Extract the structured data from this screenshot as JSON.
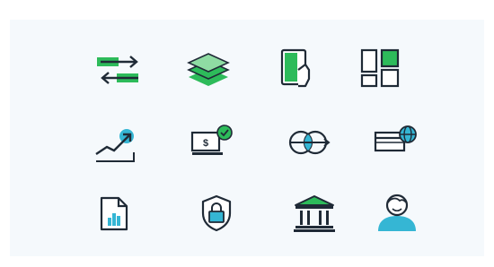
{
  "palette": {
    "ink": "#1f2a36",
    "green": "#2dbb5a",
    "green_light": "#8fdca3",
    "teal": "#35b6d4",
    "panel_bg": "#f5f9fc"
  },
  "icons": [
    {
      "row": 1,
      "col": 1,
      "name": "transfer-arrows-icon"
    },
    {
      "row": 1,
      "col": 2,
      "name": "stacked-layers-icon"
    },
    {
      "row": 1,
      "col": 3,
      "name": "tablet-hand-icon"
    },
    {
      "row": 1,
      "col": 4,
      "name": "dashboard-grid-icon"
    },
    {
      "row": 2,
      "col": 1,
      "name": "growth-chart-icon"
    },
    {
      "row": 2,
      "col": 2,
      "name": "verified-payment-icon"
    },
    {
      "row": 2,
      "col": 3,
      "name": "currency-exchange-icon"
    },
    {
      "row": 2,
      "col": 4,
      "name": "global-card-icon"
    },
    {
      "row": 3,
      "col": 1,
      "name": "report-document-icon"
    },
    {
      "row": 3,
      "col": 2,
      "name": "security-shield-icon"
    },
    {
      "row": 3,
      "col": 3,
      "name": "bank-building-icon"
    },
    {
      "row": 3,
      "col": 4,
      "name": "user-profile-icon"
    }
  ]
}
